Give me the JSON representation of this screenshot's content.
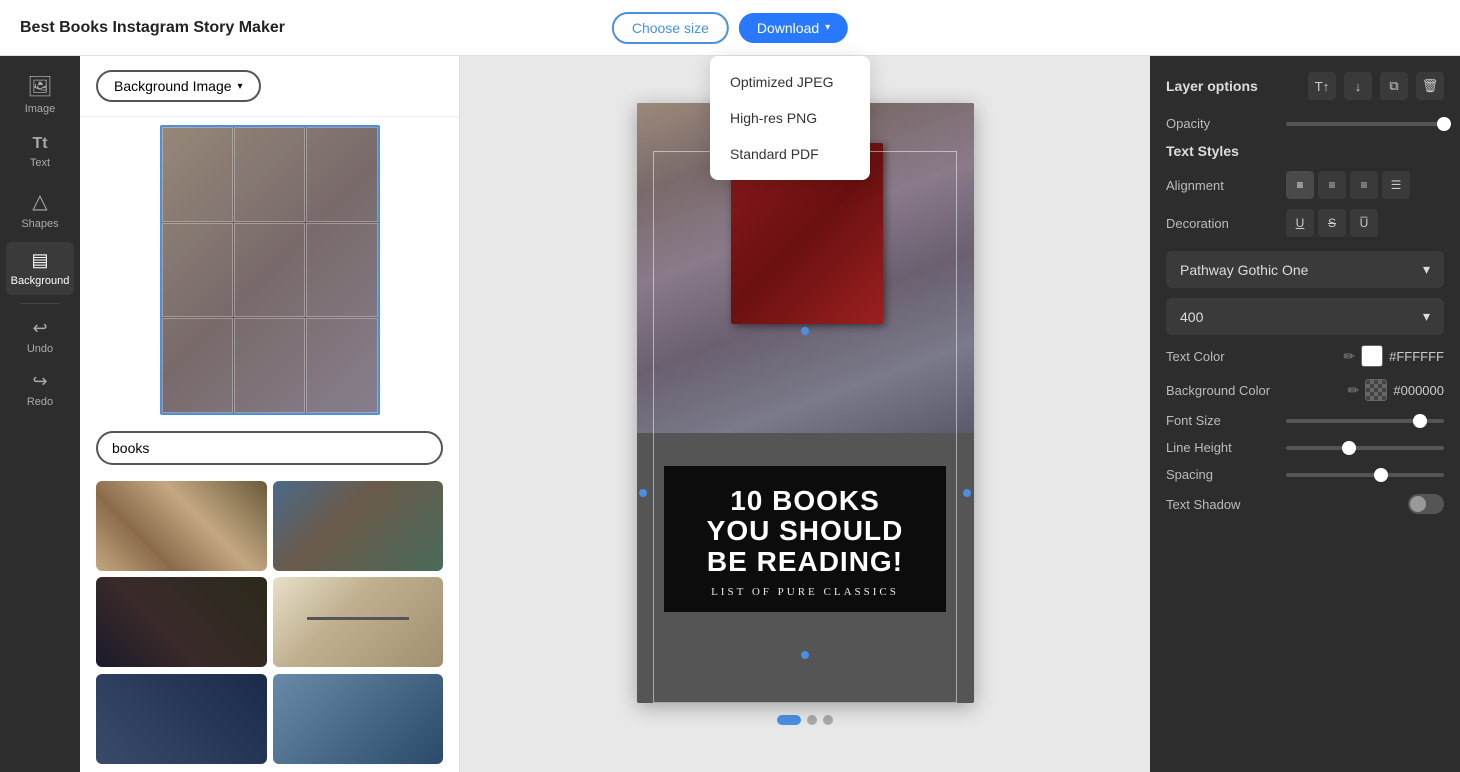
{
  "app": {
    "title": "Best Books Instagram Story Maker"
  },
  "header": {
    "choose_size_label": "Choose size",
    "download_label": "Download",
    "download_arrow": "▾"
  },
  "download_menu": {
    "items": [
      {
        "id": "optimized-jpeg",
        "label": "Optimized JPEG"
      },
      {
        "id": "high-res-png",
        "label": "High-res PNG"
      },
      {
        "id": "standard-pdf",
        "label": "Standard PDF"
      }
    ]
  },
  "sidebar": {
    "items": [
      {
        "id": "image",
        "icon": "🖼",
        "label": "Image"
      },
      {
        "id": "text",
        "icon": "Tt",
        "label": "Text"
      },
      {
        "id": "shapes",
        "icon": "△",
        "label": "Shapes"
      },
      {
        "id": "background",
        "icon": "▤",
        "label": "Background"
      }
    ],
    "undo_label": "Undo",
    "redo_label": "Redo"
  },
  "panel": {
    "background_image_btn": "Background Image",
    "search_placeholder": "books",
    "search_value": "books"
  },
  "canvas": {
    "main_text_line1": "10 BOOKS",
    "main_text_line2": "YOU SHOULD",
    "main_text_line3": "BE READING!",
    "sub_text": "LIST OF PURE CLASSICS"
  },
  "right_panel": {
    "layer_options_label": "Layer options",
    "layer_icons": [
      "T↑",
      "↓",
      "⧉",
      "🗑"
    ],
    "opacity_label": "Opacity",
    "opacity_value": 100,
    "section_text_styles": "Text Styles",
    "alignment_label": "Alignment",
    "decoration_label": "Decoration",
    "font_name": "Pathway Gothic One",
    "font_weight": "400",
    "text_color_label": "Text Color",
    "text_color_hex": "#FFFFFF",
    "bg_color_label": "Background Color",
    "bg_color_hex": "#000000",
    "font_size_label": "Font Size",
    "font_size_value": 85,
    "line_height_label": "Line Height",
    "line_height_value": 40,
    "spacing_label": "Spacing",
    "spacing_value": 60,
    "text_shadow_label": "Text Shadow"
  }
}
